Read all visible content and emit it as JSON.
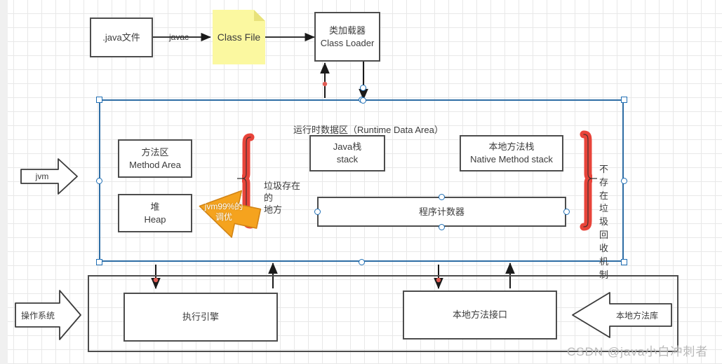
{
  "canvas": {
    "title": "JVM Architecture Diagram",
    "grid": true,
    "background": "#ffffff",
    "gridline_color": "#e8e8e8"
  },
  "top_flow": {
    "java_file": {
      "label": ".java文件"
    },
    "javac_edge": {
      "label": "javac"
    },
    "class_file": {
      "label": "Class File",
      "fill": "#fbf8a0"
    },
    "class_loader": {
      "line1": "类加载器",
      "line2": "Class Loader"
    }
  },
  "runtime_area": {
    "title": "运行时数据区（Runtime Data Area）",
    "selected": true,
    "selection_color": "#2e6da4",
    "method_area": {
      "line1": "方法区",
      "line2": "Method Area"
    },
    "heap": {
      "line1": "堆",
      "line2": "Heap"
    },
    "java_stack": {
      "line1": "Java栈",
      "line2": "stack"
    },
    "native_method_stack": {
      "line1": "本地方法栈",
      "line2": "Native Method stack"
    },
    "program_counter": {
      "label": "程序计数器",
      "selected": true
    },
    "left_brace": {
      "label": "垃圾存在的\n地方",
      "color": "#e8443a"
    },
    "right_brace": {
      "label": "不存\n在垃\n圾回\n收机\n制",
      "color": "#e8443a"
    },
    "tuning_arrow": {
      "label": "jvm99%的\n调优",
      "fill": "#f5a31e",
      "stroke": "#d18416"
    }
  },
  "left_arrows": {
    "jvm": {
      "label": "jvm"
    },
    "os": {
      "label": "操作系统"
    }
  },
  "bottom_area": {
    "execution_engine": {
      "label": "执行引擎"
    },
    "native_interface": {
      "label": "本地方法接口"
    },
    "native_library_arrow": {
      "label": "本地方法库"
    }
  },
  "watermark": {
    "text": "CSDN @java小白冲刺者",
    "color": "#b9b9b9"
  }
}
